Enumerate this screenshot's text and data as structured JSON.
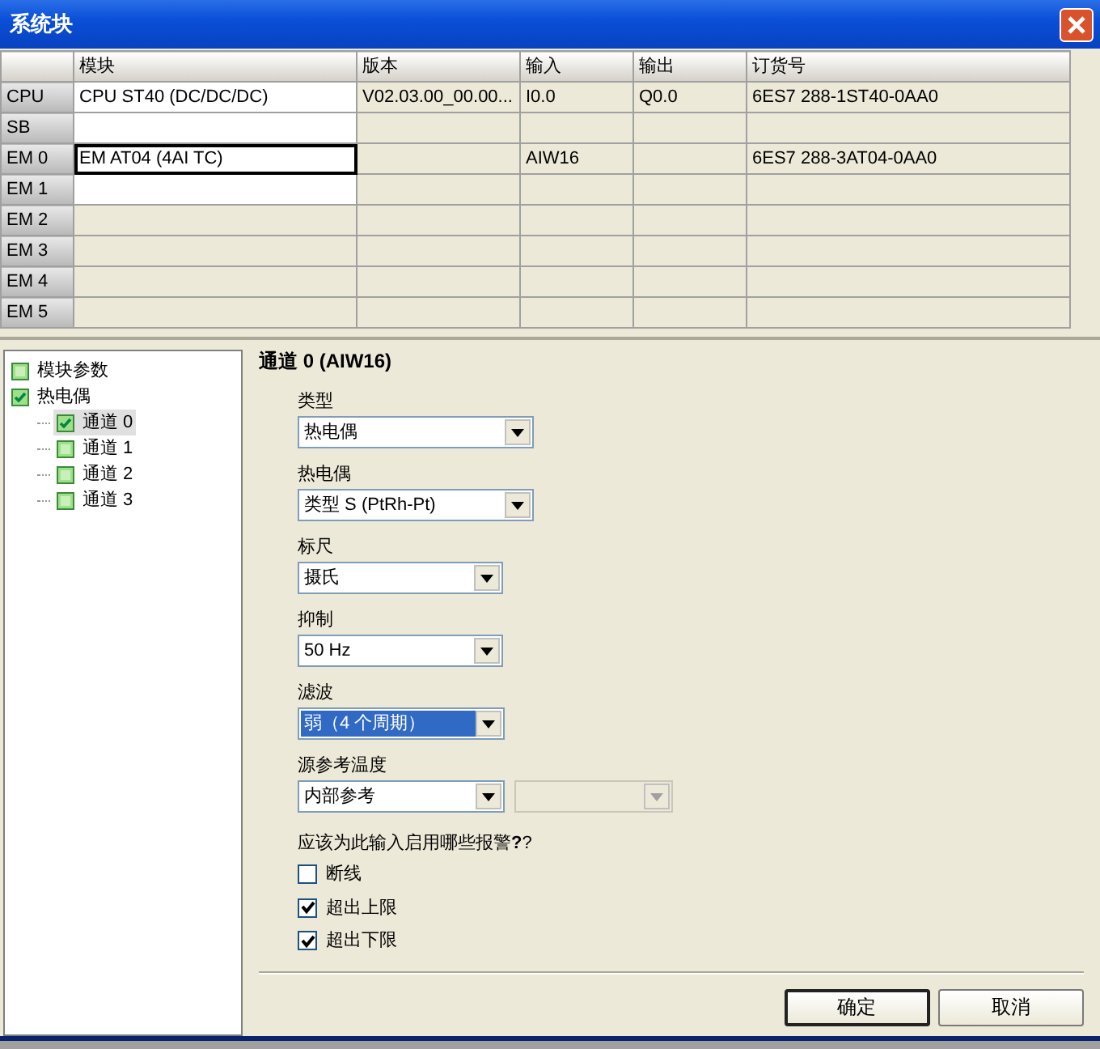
{
  "window": {
    "title": "系统块"
  },
  "table": {
    "columns": [
      "模块",
      "版本",
      "输入",
      "输出",
      "订货号"
    ],
    "rows": [
      {
        "header": "CPU",
        "editable": true,
        "focused": false,
        "cells": [
          "CPU ST40 (DC/DC/DC)",
          "V02.03.00_00.00...",
          "I0.0",
          "Q0.0",
          "6ES7 288-1ST40-0AA0"
        ]
      },
      {
        "header": "SB",
        "editable": true,
        "focused": false,
        "cells": [
          "",
          "",
          "",
          "",
          ""
        ]
      },
      {
        "header": "EM 0",
        "editable": true,
        "focused": true,
        "cells": [
          "EM AT04 (4AI TC)",
          "",
          "AIW16",
          "",
          "6ES7 288-3AT04-0AA0"
        ]
      },
      {
        "header": "EM 1",
        "editable": true,
        "focused": false,
        "cells": [
          "",
          "",
          "",
          "",
          ""
        ]
      },
      {
        "header": "EM 2",
        "editable": false,
        "focused": false,
        "cells": [
          "",
          "",
          "",
          "",
          ""
        ]
      },
      {
        "header": "EM 3",
        "editable": false,
        "focused": false,
        "cells": [
          "",
          "",
          "",
          "",
          ""
        ]
      },
      {
        "header": "EM 4",
        "editable": false,
        "focused": false,
        "cells": [
          "",
          "",
          "",
          "",
          ""
        ]
      },
      {
        "header": "EM 5",
        "editable": false,
        "focused": false,
        "cells": [
          "",
          "",
          "",
          "",
          ""
        ]
      }
    ]
  },
  "tree": {
    "items": [
      {
        "label": "模块参数",
        "checked": false,
        "selected": false
      },
      {
        "label": "热电偶",
        "checked": true,
        "selected": false,
        "children": [
          {
            "label": "通道 0",
            "checked": true,
            "selected": true
          },
          {
            "label": "通道 1",
            "checked": false,
            "selected": false
          },
          {
            "label": "通道 2",
            "checked": false,
            "selected": false
          },
          {
            "label": "通道 3",
            "checked": false,
            "selected": false
          }
        ]
      }
    ]
  },
  "panel": {
    "heading": "通道 0 (AIW16)",
    "fields": [
      {
        "label": "类型",
        "value": "热电偶",
        "highlighted": false
      },
      {
        "label": "热电偶",
        "value": "类型 S (PtRh-Pt)",
        "highlighted": false
      },
      {
        "label": "标尺",
        "value": "摄氏",
        "highlighted": false
      },
      {
        "label": "抑制",
        "value": "50 Hz",
        "highlighted": false
      },
      {
        "label": "滤波",
        "value": "弱（4 个周期）",
        "highlighted": true
      },
      {
        "label": "源参考温度",
        "value": "内部参考",
        "highlighted": false,
        "secondary": {
          "disabled": true
        }
      }
    ],
    "alarms_question": "应该为此输入启用哪些报警**?**?",
    "alarms": [
      {
        "label": "断线",
        "checked": false
      },
      {
        "label": "超出上限",
        "checked": true
      },
      {
        "label": "超出下限",
        "checked": true
      }
    ]
  },
  "buttons": [
    {
      "label": "确定",
      "default": true
    },
    {
      "label": "取消",
      "default": false
    }
  ]
}
